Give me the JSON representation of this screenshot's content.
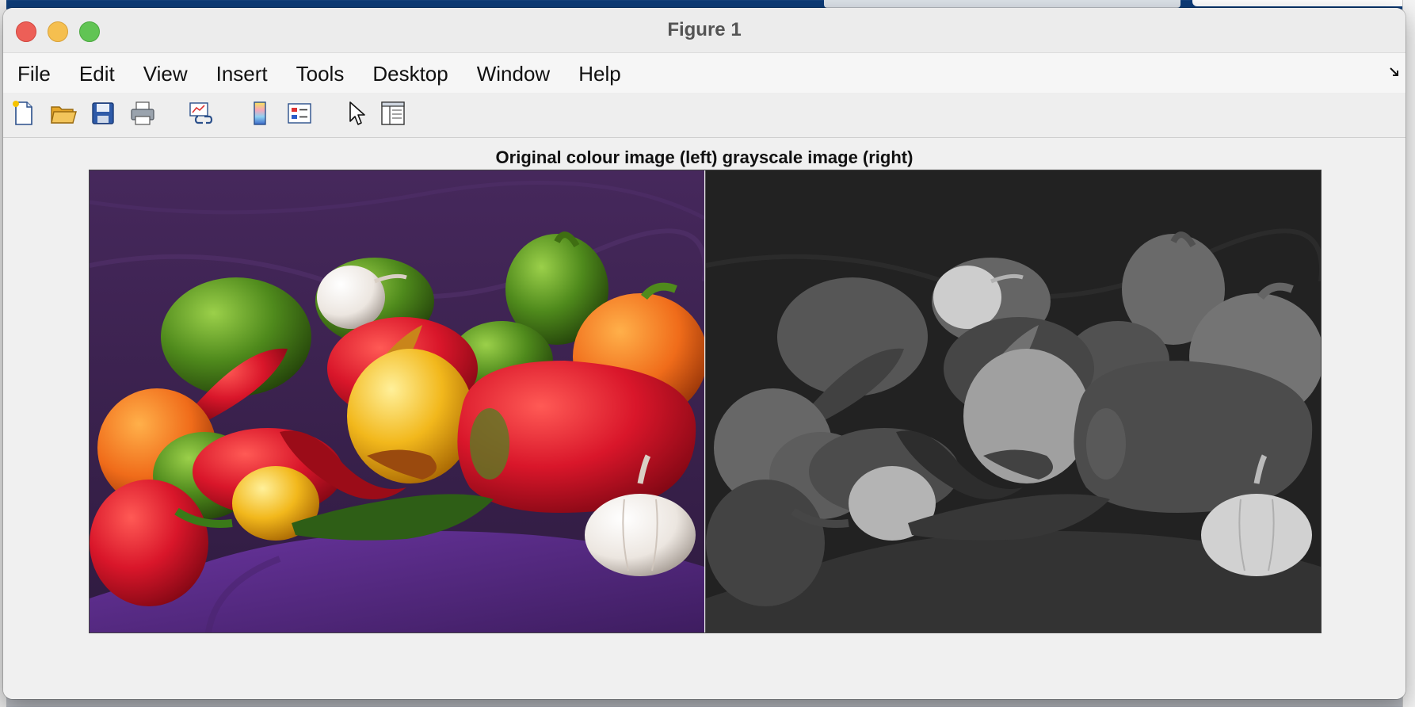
{
  "window": {
    "title": "Figure 1"
  },
  "menu": [
    {
      "label": "File"
    },
    {
      "label": "Edit"
    },
    {
      "label": "View"
    },
    {
      "label": "Insert"
    },
    {
      "label": "Tools"
    },
    {
      "label": "Desktop"
    },
    {
      "label": "Window"
    },
    {
      "label": "Help"
    }
  ],
  "toolbar": [
    {
      "icon": "new-figure-icon"
    },
    {
      "icon": "open-file-icon"
    },
    {
      "icon": "save-icon"
    },
    {
      "icon": "print-icon"
    },
    {
      "icon": "link-plot-icon"
    },
    {
      "icon": "insert-colorbar-icon"
    },
    {
      "icon": "insert-legend-icon"
    },
    {
      "icon": "edit-plot-arrow-icon"
    },
    {
      "icon": "property-inspector-icon"
    }
  ],
  "figure": {
    "title": "Original colour image (left) grayscale image (right)",
    "colors": {
      "background_cloth": "#3b2150",
      "tablecloth": "#5b2d86",
      "red_pepper": "#d9162a",
      "green_pepper": "#4f8a1c",
      "orange_pepper": "#f06c1a",
      "yellow_pepper": "#f2b81c",
      "garlic": "#ece6e0"
    }
  }
}
